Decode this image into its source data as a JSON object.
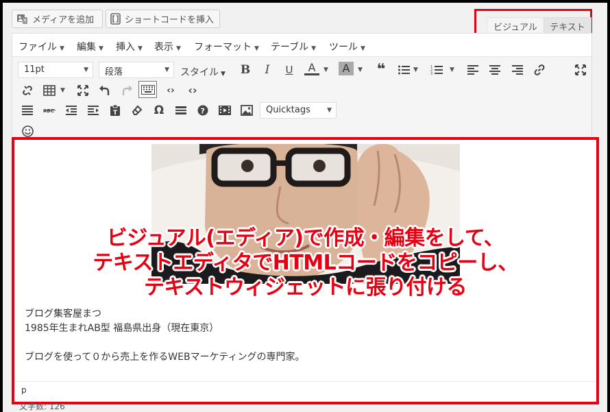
{
  "media_button": {
    "label": "メディアを追加",
    "icon": "media-icon"
  },
  "shortcode_button": {
    "label": "ショートコードを挿入",
    "icon": "shortcode-icon"
  },
  "editor_tabs": {
    "visual": "ビジュアル",
    "text": "テキスト"
  },
  "menubar": [
    {
      "label": "ファイル"
    },
    {
      "label": "編集"
    },
    {
      "label": "挿入"
    },
    {
      "label": "表示"
    },
    {
      "label": "フォーマット"
    },
    {
      "label": "テーブル"
    },
    {
      "label": "ツール"
    }
  ],
  "toolbar": {
    "font_size": "11pt",
    "paragraph": "段落",
    "style": "スタイル",
    "bold": "B",
    "italic": "I",
    "underline": "U",
    "font_color": "A",
    "bg_color": "A",
    "quicktags": "Quicktags",
    "omega": "Ω"
  },
  "overlay_text": {
    "line1": "ビジュアル(エディア)で作成・編集をして、",
    "line2": "テキストエディタでHTMLコードをコピーし、",
    "line3": "テキストウィジェットに張り付ける"
  },
  "content": {
    "line1": "ブログ集客屋まつ",
    "line2": "1985年生まれAB型 福島県出身（現在東京）",
    "line3": "ブログを使って０から売上を作るWEBマーケティングの専門家。"
  },
  "status_path": "p",
  "word_count": "文字数: 126",
  "colors": {
    "highlight_border": "#e60012",
    "overlay_text": "#e60012"
  }
}
